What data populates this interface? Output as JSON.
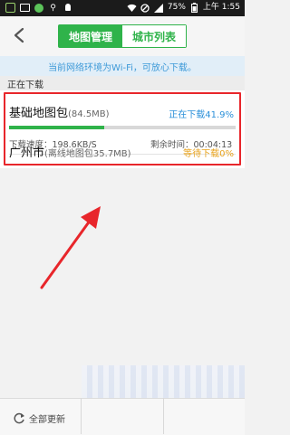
{
  "status_bar": {
    "battery": "75%",
    "time": "上午 1:55",
    "icons": [
      "app-icon",
      "image-icon",
      "green-app-icon",
      "usb-icon",
      "android-icon",
      "wifi-icon",
      "mute-icon",
      "signal-icon",
      "battery-icon"
    ]
  },
  "header": {
    "tabs": [
      {
        "label": "地图管理",
        "active": true
      },
      {
        "label": "城市列表",
        "active": false
      }
    ]
  },
  "notice": {
    "text": "当前网络环境为Wi-Fi，可放心下载。"
  },
  "section": {
    "title": "正在下载"
  },
  "downloads": [
    {
      "name": "基础地图包",
      "size": "(84.5MB)",
      "status": "正在下载41.9%",
      "progress": 0.419,
      "speed": "下载速度：198.6KB/S",
      "remaining": "剩余时间：00:04:13"
    },
    {
      "name": "广州市",
      "size": "(离线地图包35.7MB)",
      "status": "等待下载0%",
      "progress": 0
    }
  ],
  "bottom_bar": {
    "update_all": "全部更新"
  },
  "colors": {
    "accent": "#2fb34a",
    "downloading": "#2b90d9",
    "waiting": "#e8a21a",
    "highlight": "#e8262b"
  }
}
